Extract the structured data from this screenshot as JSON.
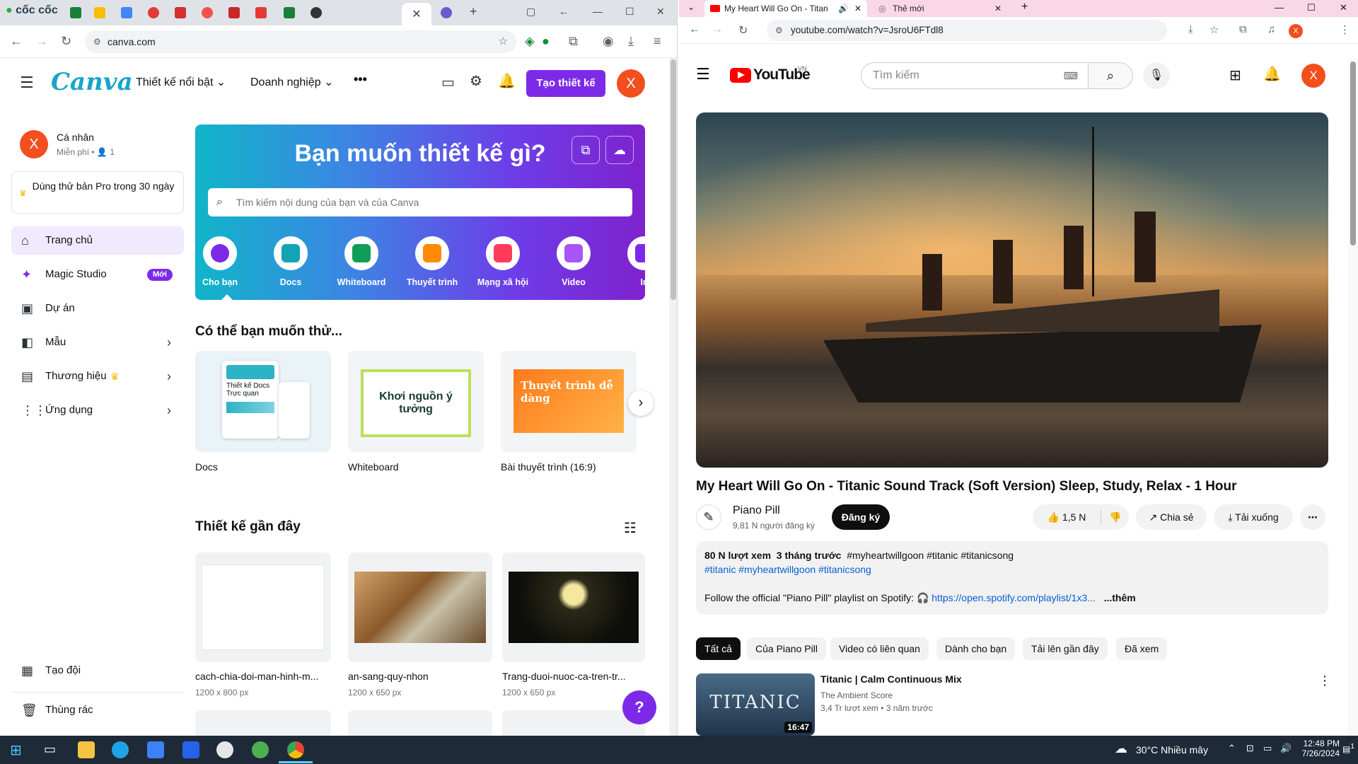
{
  "left_browser": {
    "brand": "cốc cốc",
    "url": "canva.com"
  },
  "canva": {
    "header": {
      "logo": "Canva",
      "menu_featured": "Thiết kế nổi bật",
      "menu_business": "Doanh nghiệp",
      "more": "•••",
      "create_button": "Tạo thiết kế",
      "avatar_letter": "X"
    },
    "account": {
      "avatar_letter": "X",
      "name": "Cá nhân",
      "plan": "Miễn phí",
      "members": "1"
    },
    "pro_trial": "Dùng thử bản Pro trong 30 ngày",
    "sidebar": [
      {
        "label": "Trang chủ",
        "icon": "home-icon"
      },
      {
        "label": "Magic Studio",
        "icon": "sparkle-icon",
        "badge": "Mới"
      },
      {
        "label": "Dự án",
        "icon": "folder-icon"
      },
      {
        "label": "Mẫu",
        "icon": "template-icon"
      },
      {
        "label": "Thương hiệu",
        "icon": "brand-icon"
      },
      {
        "label": "Ứng dụng",
        "icon": "apps-grid-icon"
      }
    ],
    "sidebar_bottom": {
      "team": "Tạo đội",
      "trash": "Thùng rác"
    },
    "hero": {
      "title": "Bạn muốn thiết kế gì?",
      "search_placeholder": "Tìm kiếm nội dung của bạn và của Canva",
      "categories": [
        {
          "label": "Cho bạn",
          "color": "#7d2ae8"
        },
        {
          "label": "Docs",
          "color": "#13a3b5"
        },
        {
          "label": "Whiteboard",
          "color": "#0f9d58"
        },
        {
          "label": "Thuyết trình",
          "color": "#ff8a00"
        },
        {
          "label": "Mạng xã hội",
          "color": "#ff3b5c"
        },
        {
          "label": "Video",
          "color": "#a855f7"
        },
        {
          "label": "In",
          "color": "#7d2ae8"
        }
      ]
    },
    "suggest": {
      "title": "Có thể bạn muốn thử...",
      "items": [
        {
          "label": "Docs",
          "thumb_text": "Thiết kế Docs Trực quan"
        },
        {
          "label": "Whiteboard",
          "thumb_text": "Khơi nguồn ý tưởng"
        },
        {
          "label": "Bài thuyết trình (16:9)",
          "thumb_text": "Thuyết trình dễ dàng"
        }
      ]
    },
    "recent": {
      "title": "Thiết kế gần đây",
      "items": [
        {
          "name": "cach-chia-doi-man-hinh-m...",
          "size": "1200 x 800 px"
        },
        {
          "name": "an-sang-quy-nhon",
          "size": "1200 x 650 px"
        },
        {
          "name": "Trang-duoi-nuoc-ca-tren-tr...",
          "size": "1200 x 650 px"
        }
      ]
    },
    "help": "?"
  },
  "right_browser": {
    "tabs": [
      {
        "title": "My Heart Will Go On - Titan"
      },
      {
        "title": "Thẻ mới"
      }
    ],
    "url": "youtube.com/watch?v=JsroU6FTdl8"
  },
  "youtube": {
    "logo": "YouTube",
    "region": "VN",
    "search_placeholder": "Tìm kiếm",
    "avatar_letter": "X",
    "video": {
      "title": "My Heart Will Go On - Titanic Sound Track (Soft Version) Sleep, Study, Relax - 1 Hour",
      "channel": "Piano Pill",
      "subscribers": "9,81 N người đăng ký",
      "subscribe": "Đăng ký",
      "likes": "1,5 N",
      "share": "Chia sẻ",
      "download": "Tải xuống",
      "views": "80 N lượt xem",
      "age": "3 tháng trước",
      "tags_line1": "#myheartwillgoon #titanic #titanicsong",
      "tags_line2": "#titanic #myheartwillgoon #titanicsong",
      "desc_text": "Follow the official \"Piano Pill\" playlist on Spotify:",
      "desc_link": "https://open.spotify.com/playlist/1x3...",
      "more": "...thêm"
    },
    "chips": [
      "Tất cả",
      "Của Piano Pill",
      "Video có liên quan",
      "Dành cho bạn",
      "Tải lên gần đây",
      "Đã xem"
    ],
    "related": {
      "title": "Titanic | Calm Continuous Mix",
      "channel": "The Ambient Score",
      "meta": "3,4 Tr lượt xem • 3 năm trước",
      "duration": "16:47",
      "thumb_text": "TITANIC"
    }
  },
  "taskbar": {
    "weather": "30°C Nhiều mây",
    "time": "12:48 PM",
    "date": "7/26/2024",
    "notif": "1"
  }
}
